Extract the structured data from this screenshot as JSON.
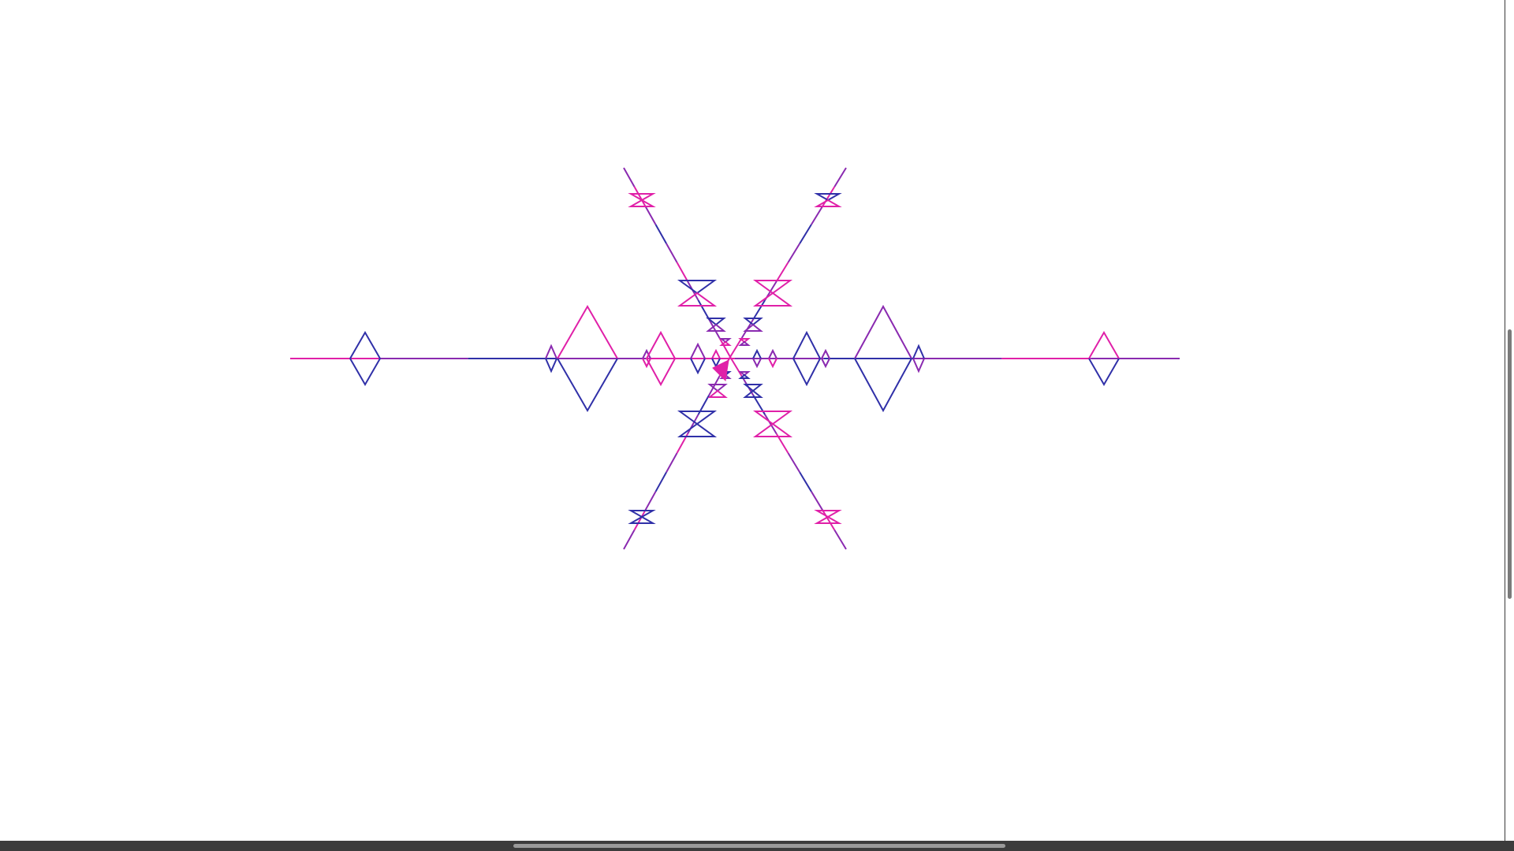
{
  "canvas": {
    "background": "#ffffff",
    "colors": {
      "pink": "#e020a8",
      "blue": "#3030a8",
      "purple": "#8a2ab0"
    },
    "cursor_icon": "turtle-arrow-icon"
  },
  "scrollbars": {
    "track_color": "#3c3c3c",
    "thumb_color": "#8a8a8a"
  }
}
